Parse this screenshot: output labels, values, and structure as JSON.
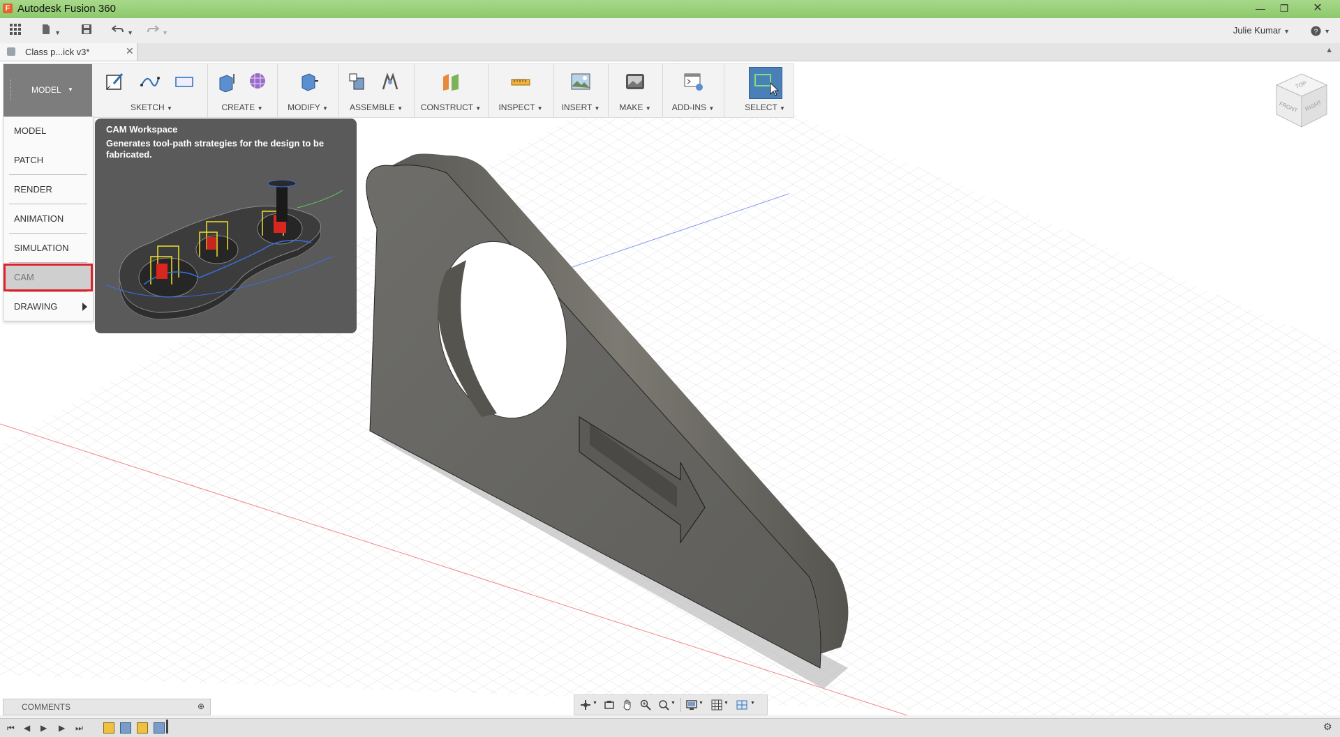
{
  "window": {
    "title": "Autodesk Fusion 360",
    "minimize_icon": "minimize-icon",
    "maximize_icon": "restore-icon",
    "close_icon": "close-icon"
  },
  "quick_access": {
    "user": "Julie Kumar",
    "icons": [
      "app-grid-icon",
      "file-icon",
      "save-icon",
      "undo-icon",
      "redo-icon",
      "help-icon"
    ]
  },
  "document_tab": {
    "name": "Class p...ick v3*"
  },
  "toolbar": {
    "workspace_label": "MODEL",
    "groups": [
      {
        "label": "SKETCH"
      },
      {
        "label": "CREATE"
      },
      {
        "label": "MODIFY"
      },
      {
        "label": "ASSEMBLE"
      },
      {
        "label": "CONSTRUCT"
      },
      {
        "label": "INSPECT"
      },
      {
        "label": "INSERT"
      },
      {
        "label": "MAKE"
      },
      {
        "label": "ADD-INS"
      },
      {
        "label": "SELECT"
      }
    ]
  },
  "workspace_menu": {
    "items": [
      {
        "label": "MODEL"
      },
      {
        "label": "PATCH"
      },
      {
        "label": "RENDER"
      },
      {
        "label": "ANIMATION"
      },
      {
        "label": "SIMULATION"
      },
      {
        "label": "CAM",
        "highlighted": true
      },
      {
        "label": "DRAWING"
      }
    ]
  },
  "tooltip": {
    "title": "CAM Workspace",
    "description": "Generates tool-path strategies for the design to be fabricated."
  },
  "viewcube": {
    "top": "TOP",
    "front": "FRONT",
    "right": "RIGHT"
  },
  "comments": {
    "label": "COMMENTS"
  },
  "colors": {
    "titlebar": "#8cc96b",
    "workspace_button": "#7d7d7d",
    "highlight_border": "#e0202a",
    "tooltip_bg": "#5a5a5a",
    "model_body": "#6b6a66",
    "select_active": "#4a7fb8"
  }
}
